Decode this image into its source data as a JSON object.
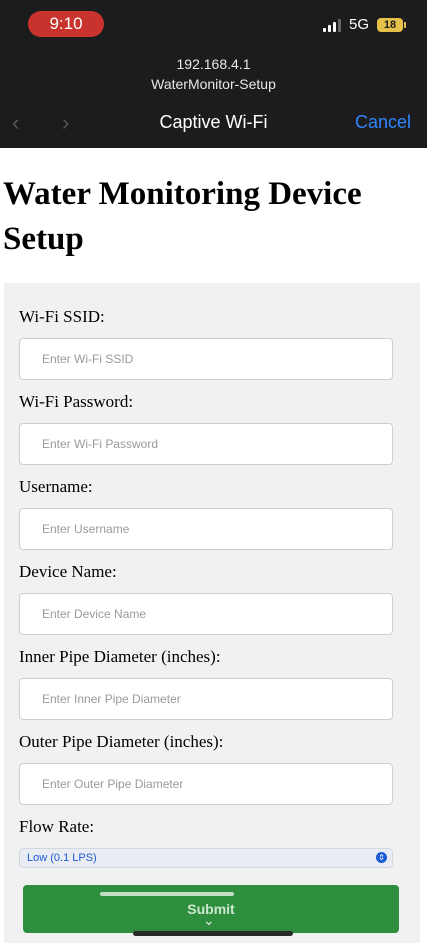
{
  "status_bar": {
    "time": "9:10",
    "network": "5G",
    "battery": "18"
  },
  "browser": {
    "address": "192.168.4.1",
    "network_name": "WaterMonitor-Setup",
    "title": "Captive Wi-Fi",
    "cancel_label": "Cancel",
    "back_icon": "‹",
    "forward_icon": "›"
  },
  "page": {
    "title": "Water Monitoring Device Setup"
  },
  "form": {
    "fields": [
      {
        "label": "Wi-Fi SSID:",
        "placeholder": "Enter Wi-Fi SSID"
      },
      {
        "label": "Wi-Fi Password:",
        "placeholder": "Enter Wi-Fi Password"
      },
      {
        "label": "Username:",
        "placeholder": "Enter Username"
      },
      {
        "label": "Device Name:",
        "placeholder": "Enter Device Name"
      },
      {
        "label": "Inner Pipe Diameter (inches):",
        "placeholder": "Enter Inner Pipe Diameter"
      },
      {
        "label": "Outer Pipe Diameter (inches):",
        "placeholder": "Enter Outer Pipe Diameter"
      }
    ],
    "flow_rate": {
      "label": "Flow Rate:",
      "selected": "Low (0.1 LPS)"
    },
    "submit_label": "Submit"
  },
  "colors": {
    "accent": "#2f86ff",
    "submit": "#2d8f3e",
    "time_pill": "#c8332d"
  }
}
